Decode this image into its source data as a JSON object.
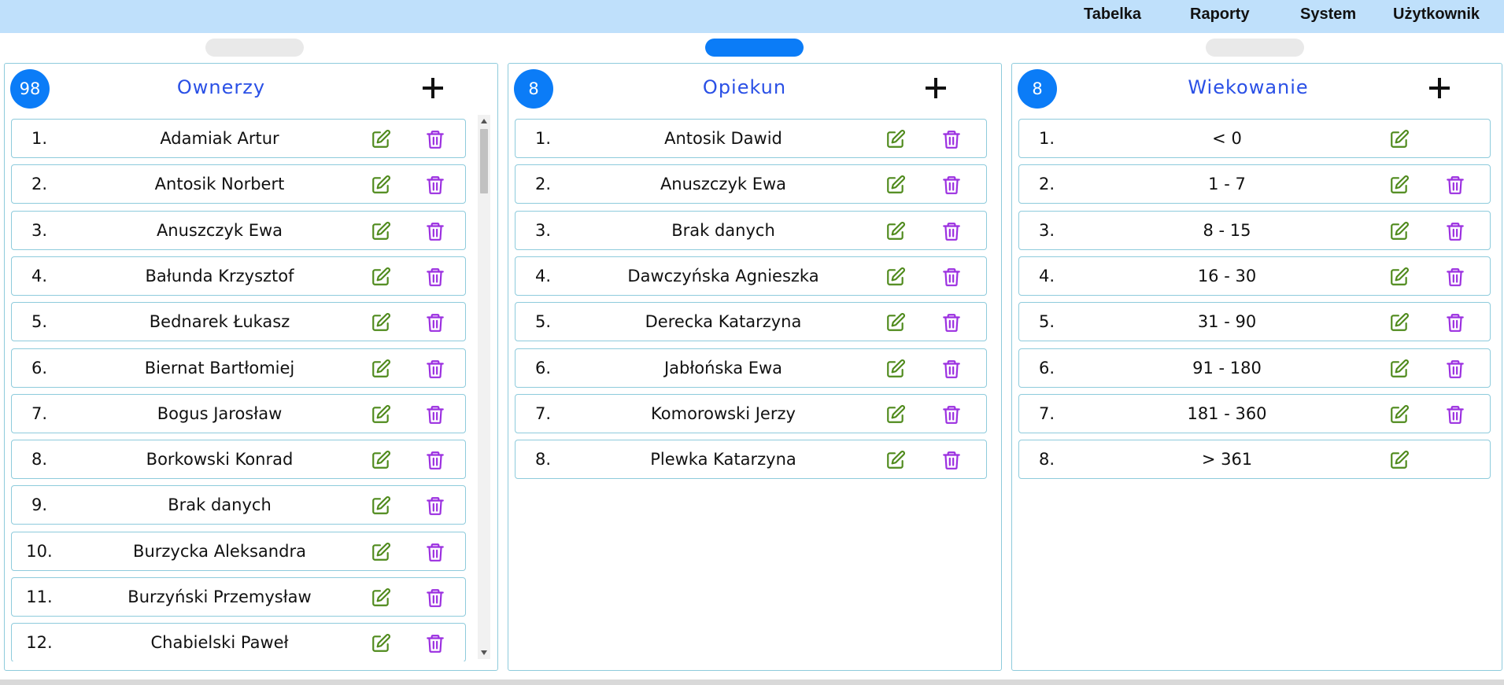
{
  "menu": [
    "Tabelka",
    "Raporty",
    "System",
    "Użytkownik"
  ],
  "panels": [
    {
      "title": "Ownerzy",
      "count": "98",
      "rows": [
        {
          "num": "1.",
          "name": "Adamiak Artur"
        },
        {
          "num": "2.",
          "name": "Antosik Norbert"
        },
        {
          "num": "3.",
          "name": "Anuszczyk Ewa"
        },
        {
          "num": "4.",
          "name": "Bałunda Krzysztof"
        },
        {
          "num": "5.",
          "name": "Bednarek Łukasz"
        },
        {
          "num": "6.",
          "name": "Biernat Bartłomiej"
        },
        {
          "num": "7.",
          "name": "Bogus Jarosław"
        },
        {
          "num": "8.",
          "name": "Borkowski Konrad"
        },
        {
          "num": "9.",
          "name": "Brak danych"
        },
        {
          "num": "10.",
          "name": "Burzycka Aleksandra"
        },
        {
          "num": "11.",
          "name": "Burzyński Przemysław"
        },
        {
          "num": "12.",
          "name": "Chabielski Paweł"
        }
      ]
    },
    {
      "title": "Opiekun",
      "count": "8",
      "rows": [
        {
          "num": "1.",
          "name": "Antosik Dawid"
        },
        {
          "num": "2.",
          "name": "Anuszczyk Ewa"
        },
        {
          "num": "3.",
          "name": "Brak danych"
        },
        {
          "num": "4.",
          "name": "Dawczyńska Agnieszka"
        },
        {
          "num": "5.",
          "name": "Derecka Katarzyna"
        },
        {
          "num": "6.",
          "name": "Jabłońska Ewa"
        },
        {
          "num": "7.",
          "name": "Komorowski Jerzy"
        },
        {
          "num": "8.",
          "name": "Plewka Katarzyna"
        }
      ]
    },
    {
      "title": "Wiekowanie",
      "count": "8",
      "rows": [
        {
          "num": "1.",
          "name": "< 0"
        },
        {
          "num": "2.",
          "name": "1 - 7"
        },
        {
          "num": "3.",
          "name": "8 - 15"
        },
        {
          "num": "4.",
          "name": "16 - 30"
        },
        {
          "num": "5.",
          "name": "31 - 90"
        },
        {
          "num": "6.",
          "name": "91 - 180"
        },
        {
          "num": "7.",
          "name": "181 - 360"
        },
        {
          "num": "8.",
          "name": "> 361"
        }
      ]
    }
  ],
  "icons": {
    "add": "plus-icon",
    "edit": "edit-icon",
    "delete": "trash-icon"
  },
  "colors": {
    "topbar": "#bfe0fb",
    "accent": "#0b7cf7",
    "title": "#2a50e6",
    "edit": "#4f8a1c",
    "delete": "#9b2fe0",
    "border": "#8ecbdc"
  }
}
